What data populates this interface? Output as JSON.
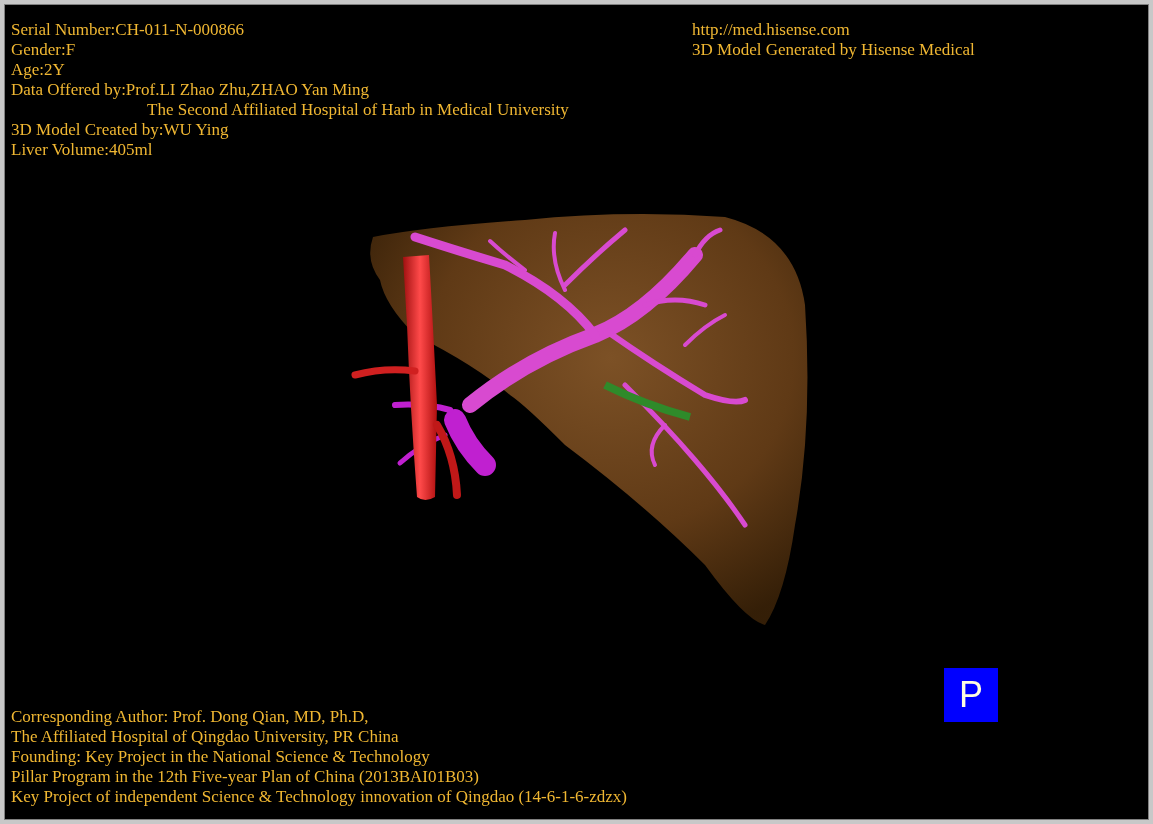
{
  "info": [
    {
      "kind": "line",
      "text": "Serial Number:CH-011-N-000866"
    },
    {
      "kind": "line",
      "text": "Gender:F"
    },
    {
      "kind": "line",
      "text": "Age:2Y"
    },
    {
      "kind": "line",
      "text": "Data Offered by:Prof.LI Zhao Zhu,ZHAO Yan Ming"
    },
    {
      "kind": "continuation",
      "text": "The Second Affiliated Hospital of Harb in Medical University"
    },
    {
      "kind": "line",
      "text": "3D Model Created by:WU Ying"
    },
    {
      "kind": "line",
      "text": "Liver Volume:405ml"
    }
  ],
  "branding": [
    "http://med.hisense.com",
    "3D Model Generated by Hisense Medical"
  ],
  "credits": [
    "Corresponding Author: Prof. Dong Qian, MD, Ph.D,",
    "The Affiliated Hospital of Qingdao University, PR China",
    "Founding: Key Project in the National Science & Technology",
    "Pillar Program in the 12th Five-year Plan of China (2013BAI01B03)",
    "Key Project of independent Science & Technology innovation of Qingdao (14-6-1-6-zdzx)"
  ],
  "projection_button": {
    "label": "P"
  }
}
